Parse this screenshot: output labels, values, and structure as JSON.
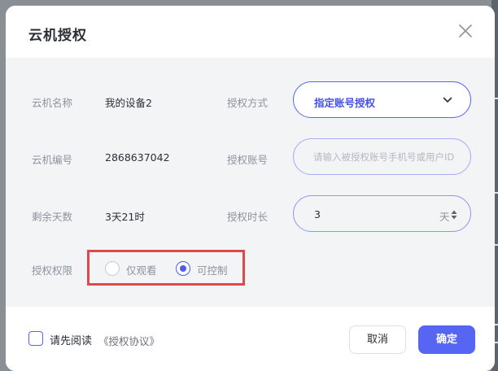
{
  "dialog": {
    "title": "云机授权",
    "close_icon": "close-icon"
  },
  "form": {
    "device_name": {
      "label": "云机名称",
      "value": "我的设备2"
    },
    "device_id": {
      "label": "云机编号",
      "value": "2868637042"
    },
    "remaining_days": {
      "label": "剩余天数",
      "value": "3天21时"
    },
    "auth_method": {
      "label": "授权方式",
      "selected": "指定账号授权",
      "icon": "chevron-down-icon"
    },
    "auth_account": {
      "label": "授权账号",
      "placeholder": "请输入被授权账号手机号或用户ID",
      "value": ""
    },
    "auth_duration": {
      "label": "授权时长",
      "value": "3",
      "unit": "天",
      "icon": "stepper-icon"
    },
    "permission": {
      "label": "授权权限",
      "options": [
        {
          "label": "仅观看",
          "selected": false
        },
        {
          "label": "可控制",
          "selected": true
        }
      ]
    }
  },
  "footer": {
    "agree_prefix": "请先阅读",
    "agree_link": "《授权协议》",
    "agree_checked": false,
    "cancel_label": "取消",
    "confirm_label": "确定"
  },
  "colors": {
    "accent": "#5666f3",
    "highlight_box": "#e0484c",
    "body_bg": "#f3f4f6"
  }
}
